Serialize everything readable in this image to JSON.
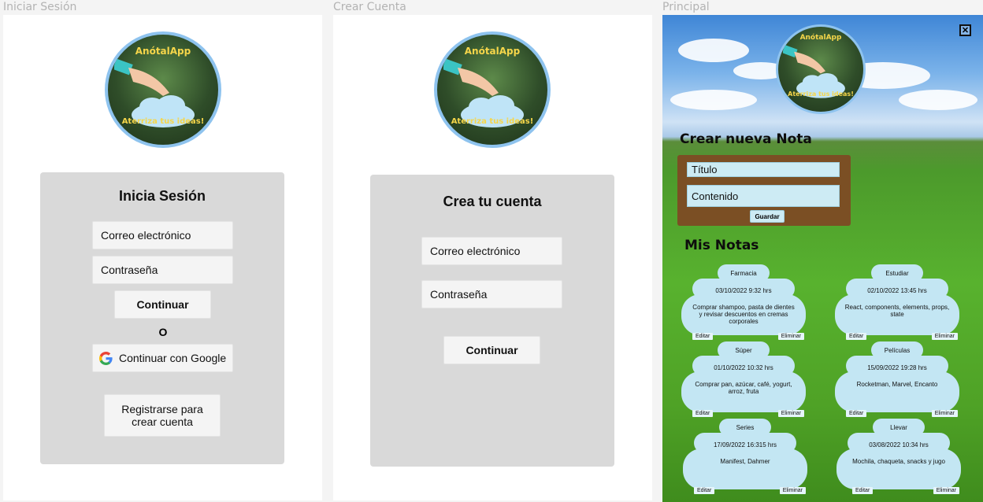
{
  "frames": {
    "login_label": "Iniciar Sesión",
    "signup_label": "Crear Cuenta",
    "main_label": "Principal"
  },
  "logo": {
    "name": "AnótalApp",
    "tagline": "Aterriza tus ideas!"
  },
  "login": {
    "title": "Inicia Sesión",
    "email_placeholder": "Correo electrónico",
    "password_placeholder": "Contraseña",
    "continue": "Continuar",
    "or": "O",
    "google": "Continuar con Google",
    "register_line1": "Registrarse para",
    "register_line2": "crear cuenta"
  },
  "signup": {
    "title": "Crea tu cuenta",
    "email_placeholder": "Correo electrónico",
    "password_placeholder": "Contraseña",
    "continue": "Continuar"
  },
  "main": {
    "new_note_title": "Crear nueva Nota",
    "title_placeholder": "Título",
    "content_placeholder": "Contenido",
    "save": "Guardar",
    "my_notes": "Mis Notas",
    "edit_label": "Editar",
    "delete_label": "Eliminar",
    "notes": [
      {
        "title": "Farmacia",
        "date": "03/10/2022   9:32 hrs",
        "text": "Comprar shampoo, pasta de dientes y revisar descuentos en cremas corporales"
      },
      {
        "title": "Estudiar",
        "date": "02/10/2022   13:45 hrs",
        "text": "React, components, elements, props, state"
      },
      {
        "title": "Súper",
        "date": "01/10/2022   10:32 hrs",
        "text": "Comprar pan, azúcar, café, yogurt, arroz, fruta"
      },
      {
        "title": "Películas",
        "date": "15/09/2022   19:28 hrs",
        "text": "Rocketman, Marvel, Encanto"
      },
      {
        "title": "Series",
        "date": "17/09/2022   16:315 hrs",
        "text": "Manifest, Dahmer"
      },
      {
        "title": "Llevar",
        "date": "03/08/2022   10:34 hrs",
        "text": "Mochila, chaqueta, snacks y jugo"
      }
    ]
  },
  "colors": {
    "panel": "#d9d9d9",
    "note_bg": "#c3e6f3",
    "form_bg": "#7b4f24",
    "logo_border": "#8ec3ee",
    "logo_text": "#f6d64a"
  },
  "icons": [
    "google-icon",
    "close-icon",
    "cloud-icon",
    "hand-icon"
  ]
}
